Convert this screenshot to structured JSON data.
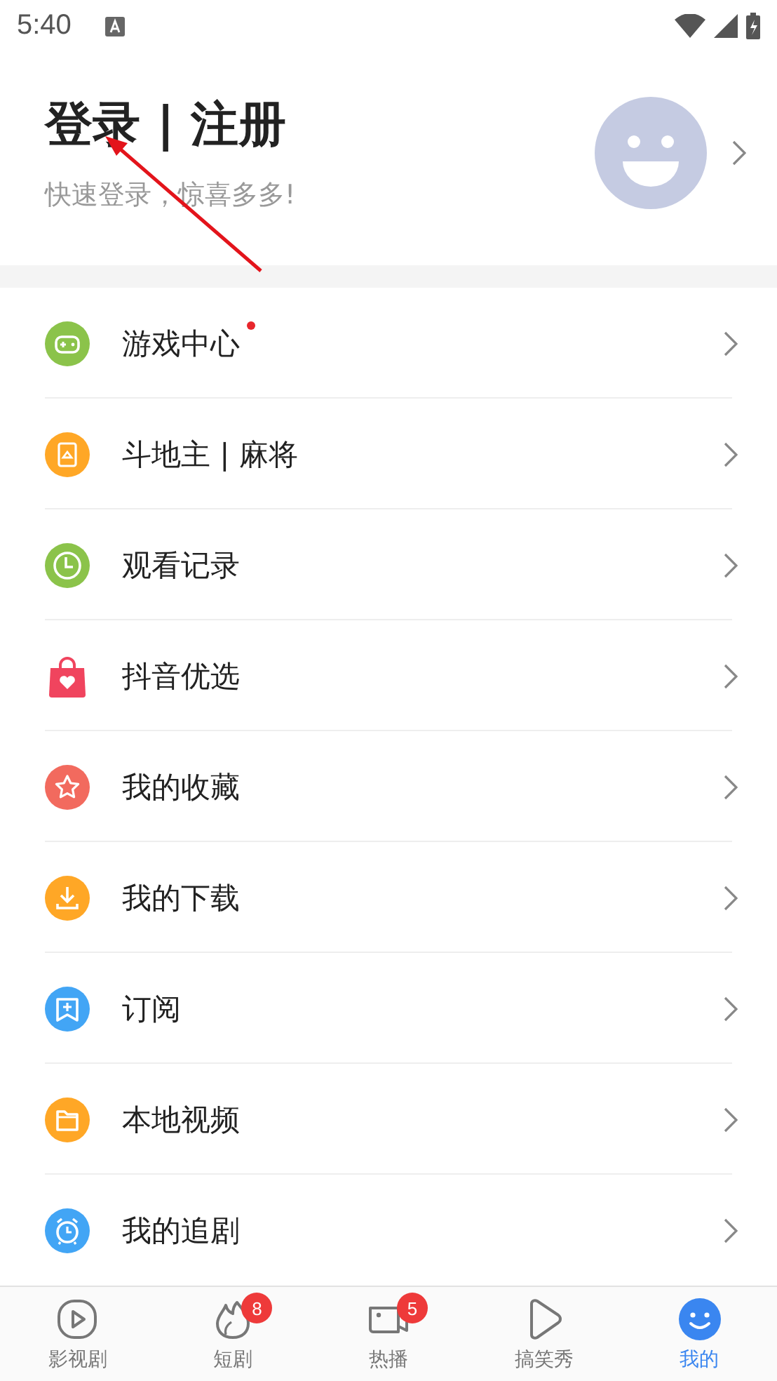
{
  "status_bar": {
    "time": "5:40"
  },
  "profile": {
    "title": "登录 | 注册",
    "subtitle": "快速登录，惊喜多多!"
  },
  "menu": [
    {
      "label": "游戏中心",
      "kind": "gamepad",
      "color": "#8bc34a",
      "dot": true
    },
    {
      "label": "斗地主 | 麻将",
      "kind": "card",
      "color": "#ffa726",
      "dot": false
    },
    {
      "label": "观看记录",
      "kind": "clock",
      "color": "#8bc34a",
      "dot": false
    },
    {
      "label": "抖音优选",
      "kind": "bag",
      "color": "#f0445e",
      "dot": false
    },
    {
      "label": "我的收藏",
      "kind": "star",
      "color": "#f26a5e",
      "dot": false
    },
    {
      "label": "我的下载",
      "kind": "download",
      "color": "#ffa726",
      "dot": false
    },
    {
      "label": "订阅",
      "kind": "subscribe",
      "color": "#42a5f5",
      "dot": false
    },
    {
      "label": "本地视频",
      "kind": "folder",
      "color": "#ffa726",
      "dot": false
    },
    {
      "label": "我的追剧",
      "kind": "alarm",
      "color": "#42a5f5",
      "dot": false
    }
  ],
  "tabs": [
    {
      "label": "影视剧",
      "kind": "play",
      "selected": false
    },
    {
      "label": "短剧",
      "kind": "flame",
      "badge": "8",
      "selected": false
    },
    {
      "label": "热播",
      "kind": "camera",
      "badge": "5",
      "selected": false
    },
    {
      "label": "搞笑秀",
      "kind": "shape",
      "selected": false
    },
    {
      "label": "我的",
      "kind": "smiley",
      "selected": true
    }
  ]
}
